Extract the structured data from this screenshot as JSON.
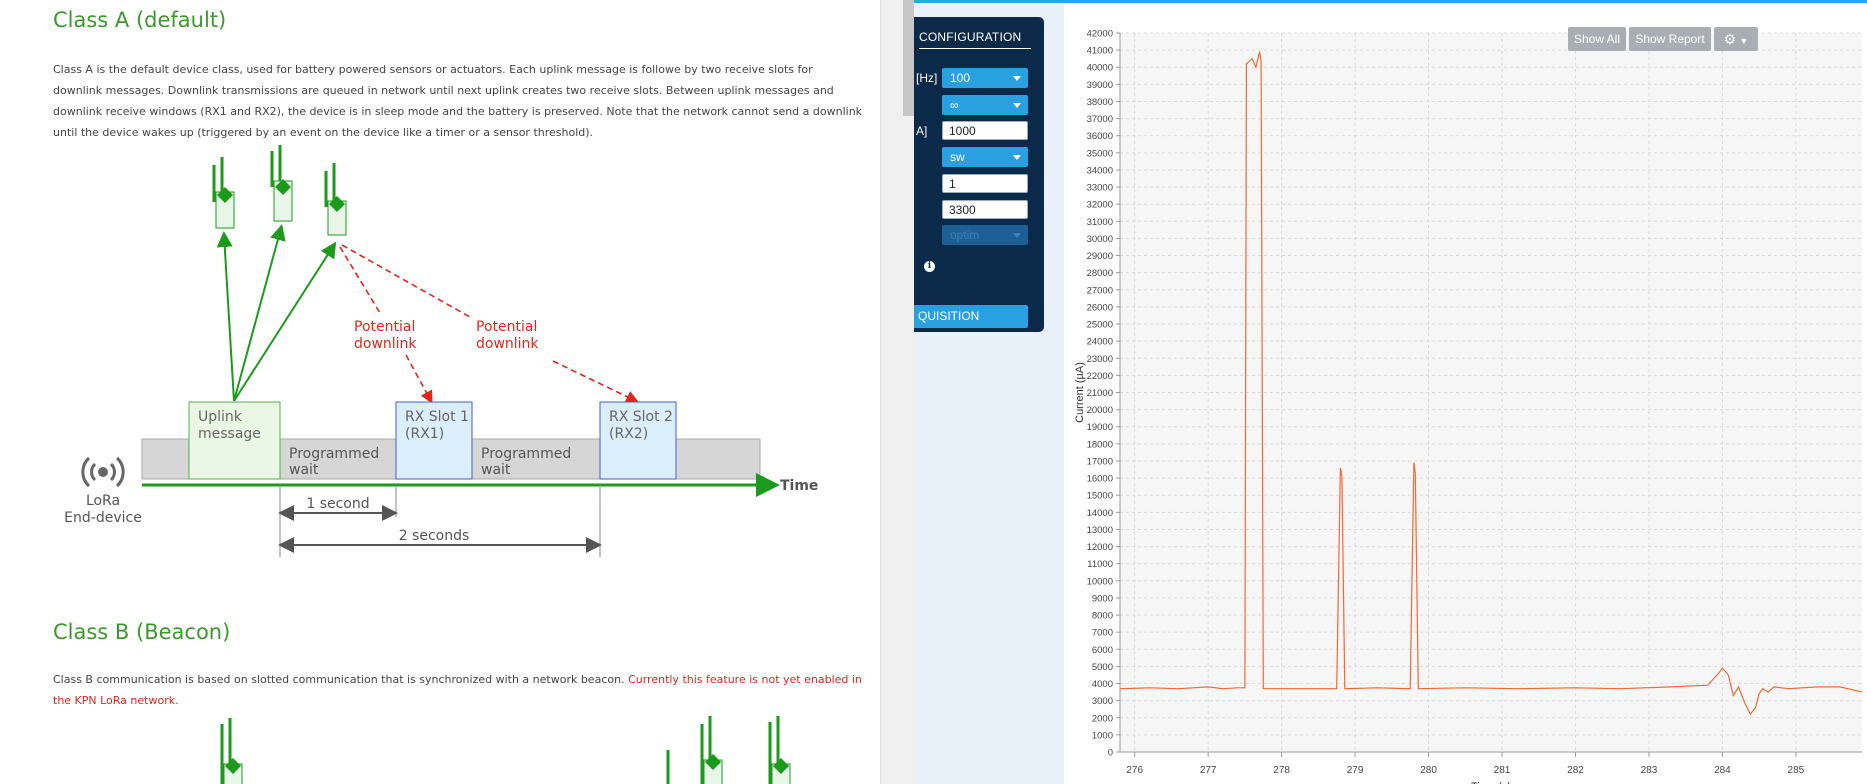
{
  "doc": {
    "class_a_title": "Class A (default)",
    "class_a_text": "Class A is the default device class, used for battery powered sensors or actuators. Each uplink message is followe by two receive slots for downlink messages. Downlink transmissions are queued in network until next uplink creates two receive slots. Between uplink messages and downlink receive windows (RX1 and RX2), the device is in sleep mode and the battery is preserved. Note that the network cannot send a downlink until the device wakes up (triggered by an event on the device like a timer or a sensor threshold).",
    "class_b_title": "Class B (Beacon)",
    "class_b_text": "Class B communication is based on slotted communication that is synchronized with a network beacon. ",
    "class_b_warning": "Currently this feature is not yet enabled in the KPN LoRa network.",
    "diagram": {
      "potential_downlink_1a": "Potential",
      "potential_downlink_1b": "downlink",
      "potential_downlink_2a": "Potential",
      "potential_downlink_2b": "downlink",
      "uplink_a": "Uplink",
      "uplink_b": "message",
      "wait1_a": "Programmed",
      "wait1_b": "wait",
      "rx1_a": "RX Slot 1",
      "rx1_b": "(RX1)",
      "wait2_a": "Programmed",
      "wait2_b": "wait",
      "rx2_a": "RX Slot 2",
      "rx2_b": "(RX2)",
      "time_label": "Time",
      "device_a": "LoRa",
      "device_b": "End-device",
      "one_second": "1 second",
      "two_seconds": "2 seconds"
    }
  },
  "config": {
    "title": "CONFIGURATION",
    "freq_label": "[Hz]",
    "freq_value": "100",
    "duration_value": "∞",
    "range_label": "A]",
    "range_value": "1000",
    "trigger_value": "sw",
    "field5_value": "1",
    "voltage_value": "3300",
    "mode_value": "optim",
    "acquisition_label": "QUISITION"
  },
  "toolbar": {
    "show_all": "Show All",
    "show_report": "Show Report"
  },
  "colors": {
    "series": "#f06a35",
    "doc_green": "#3a9a2a",
    "warning_red": "#e0261b",
    "panel_navy": "#0b2a4a",
    "accent_blue": "#29a0e0"
  },
  "chart_data": {
    "type": "line",
    "ylabel": "Current (µA)",
    "xlabel": "Time (s)",
    "xlim": [
      275.8,
      285.9
    ],
    "ylim": [
      0,
      42000
    ],
    "x_ticks": [
      276,
      277,
      278,
      279,
      280,
      281,
      282,
      283,
      284,
      285
    ],
    "y_ticks": [
      0,
      1000,
      2000,
      3000,
      4000,
      5000,
      6000,
      7000,
      8000,
      9000,
      10000,
      11000,
      12000,
      13000,
      14000,
      15000,
      16000,
      17000,
      18000,
      19000,
      20000,
      21000,
      22000,
      23000,
      24000,
      25000,
      26000,
      27000,
      28000,
      29000,
      30000,
      31000,
      32000,
      33000,
      34000,
      35000,
      36000,
      37000,
      38000,
      39000,
      40000,
      41000,
      42000
    ],
    "grid": true,
    "series": [
      {
        "x": [
          275.8,
          276.2,
          276.6,
          277.0,
          277.2,
          277.4,
          277.5,
          277.52,
          277.6,
          277.65,
          277.7,
          277.72,
          277.75,
          278.2,
          278.75,
          278.8,
          278.82,
          278.86,
          279.3,
          279.75,
          279.8,
          279.82,
          279.86,
          280.5,
          281.2,
          282.0,
          282.6,
          283.3,
          283.8,
          283.95,
          284.0,
          284.08,
          284.15,
          284.22,
          284.3,
          284.38,
          284.45,
          284.5,
          284.55,
          284.62,
          284.7,
          284.9,
          285.3,
          285.6,
          285.9
        ],
        "y": [
          3700,
          3750,
          3700,
          3800,
          3700,
          3750,
          3750,
          40200,
          40500,
          40000,
          40900,
          40300,
          3700,
          3700,
          3700,
          16600,
          16100,
          3700,
          3750,
          3700,
          16900,
          16300,
          3700,
          3750,
          3700,
          3750,
          3700,
          3800,
          3900,
          4600,
          4900,
          4500,
          3300,
          3800,
          2900,
          2200,
          2600,
          3400,
          3700,
          3500,
          3800,
          3700,
          3800,
          3800,
          3500
        ]
      }
    ]
  }
}
